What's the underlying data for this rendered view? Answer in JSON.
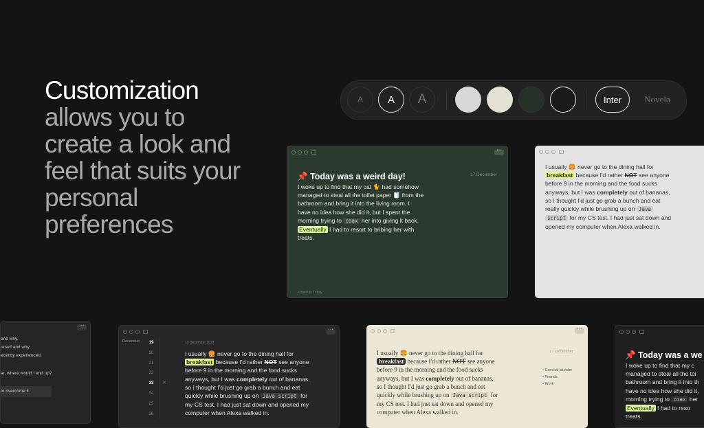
{
  "headline": {
    "title": "Customization",
    "subtitle": "allows you to create a look and feel that suits your personal preferences"
  },
  "toolbar": {
    "size_small": "A",
    "size_medium": "A",
    "size_large": "A",
    "fonts": [
      "Inter",
      "Novela"
    ],
    "swatches": [
      "#d8d8d8",
      "#e5e1d2",
      "#243126",
      "#1a1a1a"
    ]
  },
  "note": {
    "title_pre": "Today was a",
    "title_struck": "weird",
    "title_post": "day!",
    "date": "17 December",
    "line1a": "I woke up to find that my cat",
    "line1b": "had somehow",
    "line2": "managed to steal all the toilet paper",
    "line2b": "from the",
    "line3": "bathroom and bring it into the living room. I",
    "line4": "have no idea how she did it, but I spent the",
    "line5a": "morning trying to",
    "line5code": "coax",
    "line5b": "her into giving it back.",
    "line6hl": "Eventually",
    "line6b": "I had to resort to bribing her with",
    "line7": "treats.",
    "back": "< Back to Today"
  },
  "note2": {
    "l1a": "I usually",
    "l1b": "never go to the dining hall for",
    "l2hl": "breakfast",
    "l2a": "because I'd rather",
    "l2strike": "NOT",
    "l2b": "see anyone",
    "l3": "before 9 in the morning and the food sucks",
    "l4a": "anyways, but I was",
    "l4bold": "completely",
    "l4b": "out of bananas,",
    "l5": "so I thought I'd just go grab a bunch and eat",
    "l6a": "really quickly while brushing up on",
    "l6code": "Java",
    "l7code": "script",
    "l7b": "for my CS test. I had just sat down and",
    "l8": "opened my computer when Alexa walked in.",
    "l6a_alt": "quickly while brushing up on",
    "l6code_alt": "Java script",
    "l6b_alt": "for",
    "l7_alt": "my CS test. I had just sat down and opened my",
    "l8_alt": "computer when Alexa walked in."
  },
  "calendar": {
    "month": "December",
    "days": [
      "19",
      "20",
      "21",
      "22",
      "23",
      "24",
      "25",
      "26"
    ],
    "date": "19 December 2022"
  },
  "tags": [
    "Comical blunder",
    "Friends",
    "Work"
  ],
  "left_partial": {
    "l1": "and why.",
    "l2": "urself and why.",
    "l3": "ecently experienced.",
    "l4": "ar, where would I end up?",
    "l5": "to overcome it."
  },
  "right_partial": {
    "title": "Today was a we",
    "l1": "I woke up to find that my c",
    "l2": "managed to steal all the toi",
    "l3": "bathroom and bring it into th",
    "l4": "have no idea how she did it,",
    "l5a": "morning trying to",
    "l5code": "coax",
    "l5b": "her",
    "l6hl": "Eventually",
    "l6b": "I had to reso",
    "l7": "treats."
  }
}
